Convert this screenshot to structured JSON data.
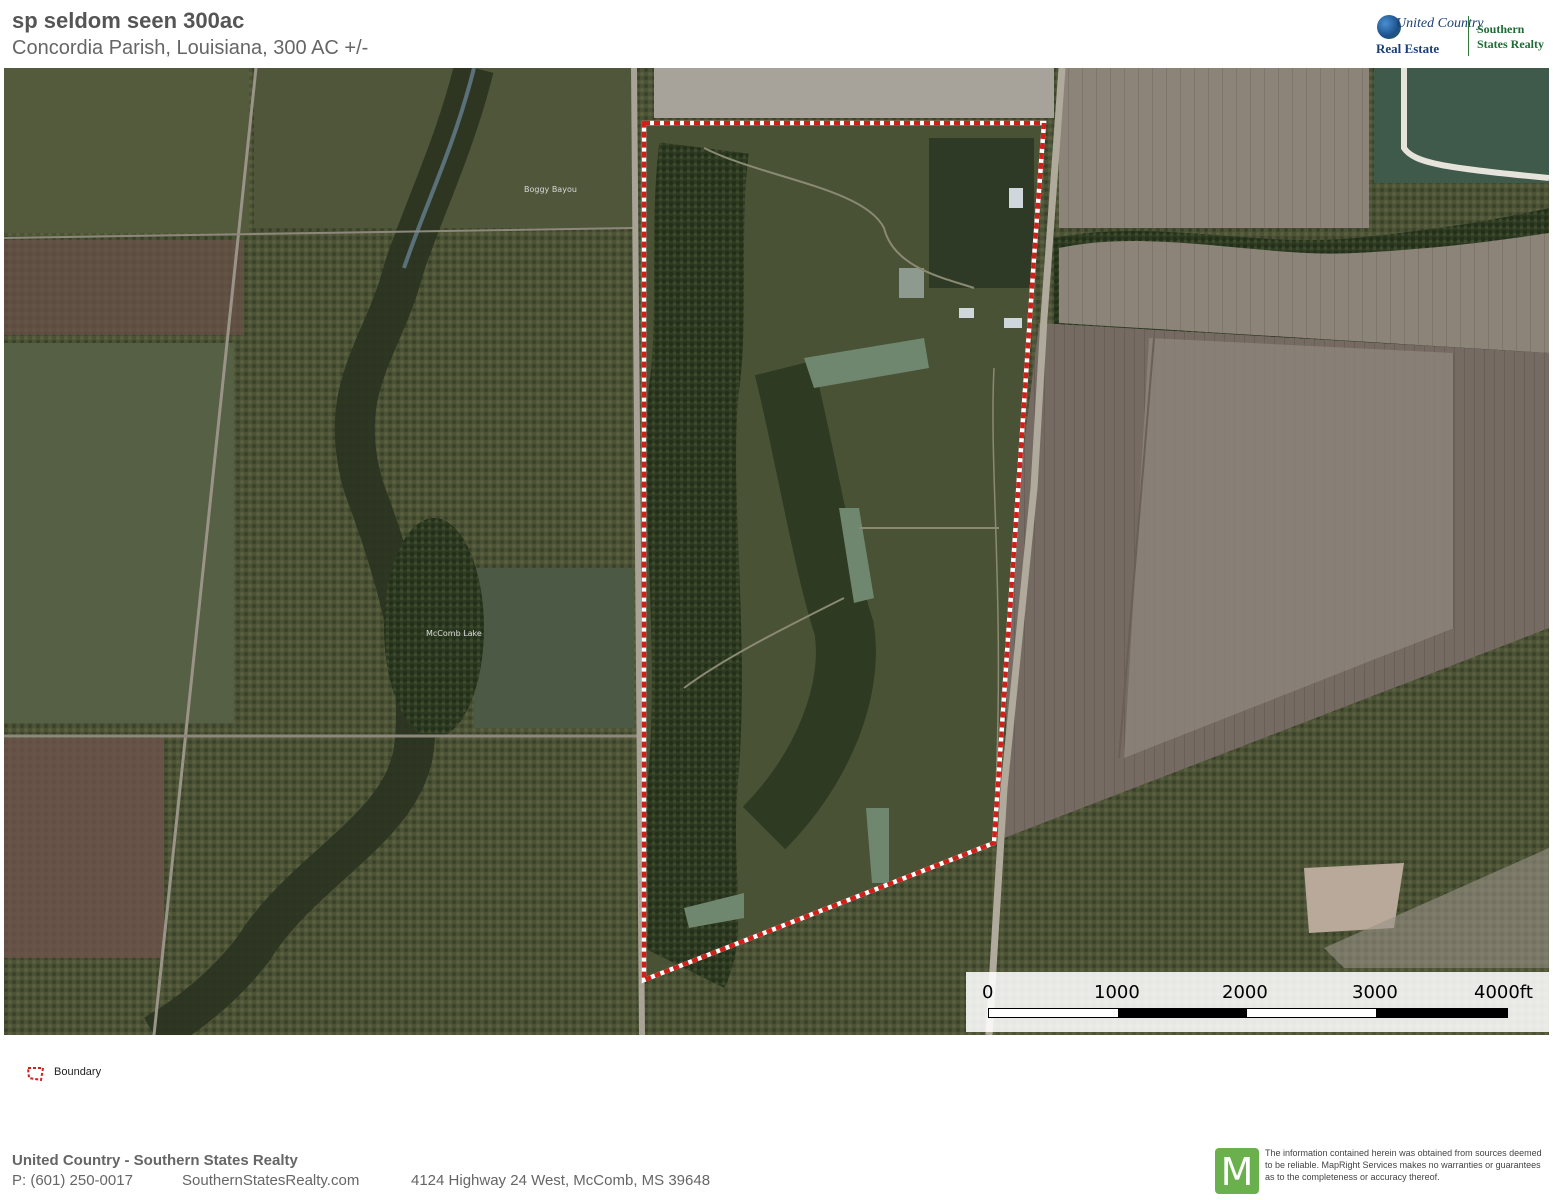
{
  "header": {
    "title": "sp seldom seen 300ac",
    "subtitle": "Concordia Parish, Louisiana, 300 AC +/-"
  },
  "logo": {
    "line1": "United Country",
    "line2": "Real Estate",
    "line3": "Southern",
    "line4": "States Realty"
  },
  "map": {
    "labels": {
      "creek": "Boggy Bayou",
      "lake": "McComb Lake"
    },
    "boundary_color": "#d0201a",
    "scale": {
      "labels": [
        "0",
        "1000",
        "2000",
        "3000",
        "4000ft"
      ]
    }
  },
  "legend": {
    "boundary_label": "Boundary"
  },
  "footer": {
    "company": "United Country - Southern States Realty",
    "phone": "P: (601) 250-0017",
    "website": "SouthernStatesRealty.com",
    "address": "4124 Highway 24 West, McComb, MS 39648",
    "disclaimer": "The information contained herein was obtained from sources deemed to be reliable. MapRight Services makes no warranties or guarantees as to the completeness or accuracy thereof.",
    "mapright_letter": "M"
  }
}
